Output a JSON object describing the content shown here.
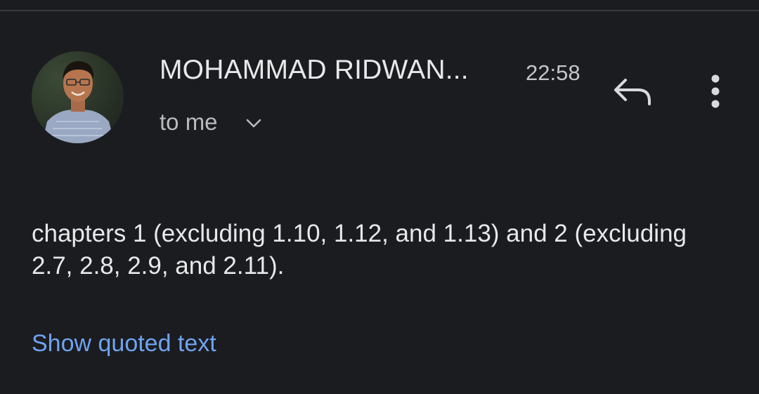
{
  "message": {
    "sender": "MOHAMMAD RIDWAN...",
    "time": "22:58",
    "recipient": "to me",
    "body": "chapters 1 (excluding 1.10, 1.12, and 1.13) and 2 (excluding 2.7, 2.8, 2.9, and 2.11).",
    "show_quoted_label": "Show quoted text"
  },
  "icons": {
    "avatar": "sender-avatar-photo",
    "recipient_toggle": "chevron-down-icon",
    "reply": "reply-icon",
    "more": "more-vert-icon"
  },
  "colors": {
    "background": "#1b1c1f",
    "text_primary": "#e7e8ea",
    "text_secondary": "#b9bbbe",
    "link": "#6fa3f1"
  }
}
